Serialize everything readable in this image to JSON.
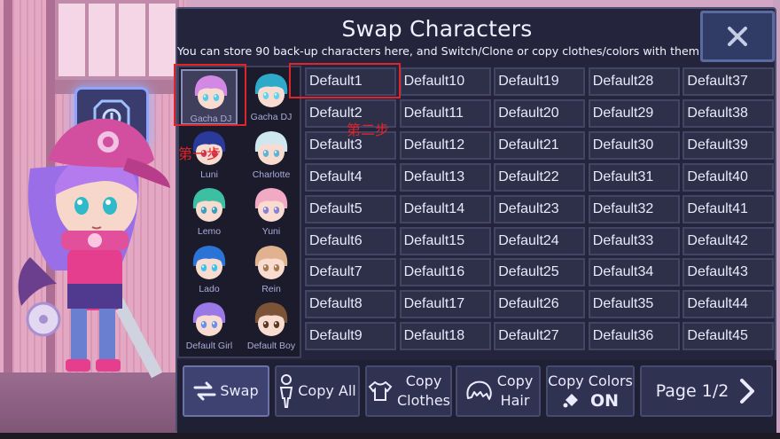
{
  "panel": {
    "title": "Swap Characters",
    "subtitle": "You can store 90 back-up characters here, and Switch/Clone or copy clothes/colors with them",
    "close_label": "X"
  },
  "characters": [
    {
      "name": "Gacha DJ",
      "hair": "#d488e6",
      "eyes": "#56c9ef",
      "selected": true
    },
    {
      "name": "Gacha DJ",
      "hair": "#2ea9c9",
      "eyes": "#5fd4ef",
      "selected": false
    },
    {
      "name": "Luni",
      "hair": "#2a3a9a",
      "eyes": "#d23a5d",
      "selected": false
    },
    {
      "name": "Charlotte",
      "hair": "#cfe8ef",
      "eyes": "#5fb3d6",
      "selected": false
    },
    {
      "name": "Lemo",
      "hair": "#3dbfa2",
      "eyes": "#3aa0c0",
      "selected": false
    },
    {
      "name": "Yuni",
      "hair": "#f2a9c3",
      "eyes": "#8a7fd6",
      "selected": false
    },
    {
      "name": "Lado",
      "hair": "#2b73d6",
      "eyes": "#3bc3ef",
      "selected": false
    },
    {
      "name": "Rein",
      "hair": "#e0b28f",
      "eyes": "#a8794e",
      "selected": false
    },
    {
      "name": "Default Girl",
      "hair": "#9a79e6",
      "eyes": "#6b8fef",
      "selected": false
    },
    {
      "name": "Default Boy",
      "hair": "#7b5438",
      "eyes": "#5a3a24",
      "selected": false
    }
  ],
  "slots": [
    [
      "Default1",
      "Default2",
      "Default3",
      "Default4",
      "Default5",
      "Default6",
      "Default7",
      "Default8",
      "Default9"
    ],
    [
      "Default10",
      "Default11",
      "Default12",
      "Default13",
      "Default14",
      "Default15",
      "Default16",
      "Default17",
      "Default18"
    ],
    [
      "Default19",
      "Default20",
      "Default21",
      "Default22",
      "Default23",
      "Default24",
      "Default25",
      "Default26",
      "Default27"
    ],
    [
      "Default28",
      "Default29",
      "Default30",
      "Default31",
      "Default32",
      "Default33",
      "Default34",
      "Default35",
      "Default36"
    ],
    [
      "Default37",
      "Default38",
      "Default39",
      "Default40",
      "Default41",
      "Default42",
      "Default43",
      "Default44",
      "Default45"
    ]
  ],
  "toolbar": {
    "swap_label": "Swap",
    "copy_all_label": "Copy All",
    "copy_clothes_label": "Copy\nClothes",
    "copy_hair_label": "Copy\nHair",
    "copy_colors_label": "Copy Colors",
    "copy_colors_state": "ON",
    "page_label": "Page 1/2"
  },
  "annotations": {
    "step1": "第一步",
    "step2": "第二步",
    "color": "#e0242b"
  }
}
